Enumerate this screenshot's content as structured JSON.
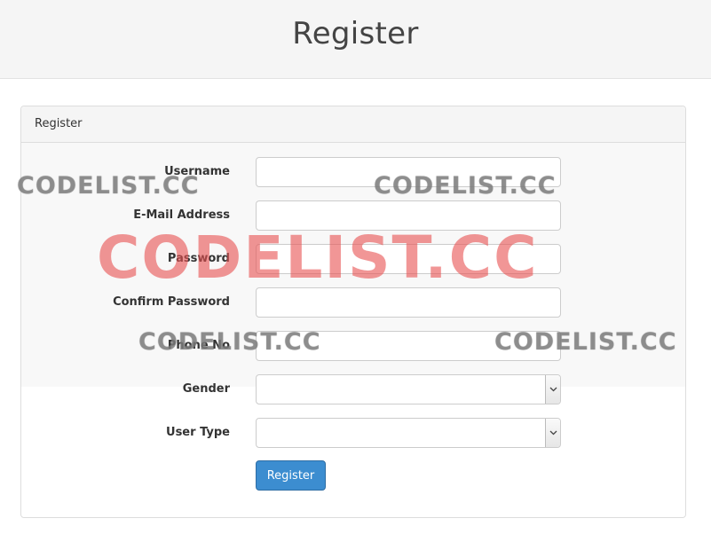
{
  "header": {
    "title": "Register"
  },
  "panel": {
    "heading": "Register"
  },
  "form": {
    "fields": [
      {
        "label": "Username",
        "value": ""
      },
      {
        "label": "E-Mail Address",
        "value": ""
      },
      {
        "label": "Password",
        "value": ""
      },
      {
        "label": "Confirm Password",
        "value": ""
      },
      {
        "label": "Phone No",
        "value": ""
      }
    ],
    "selects": [
      {
        "label": "Gender",
        "selected": ""
      },
      {
        "label": "User Type",
        "selected": ""
      }
    ],
    "submit_label": "Register"
  },
  "watermark": {
    "text": "CODELIST.CC",
    "small_color": "#7f7f7f",
    "big_color": "#e85050"
  }
}
